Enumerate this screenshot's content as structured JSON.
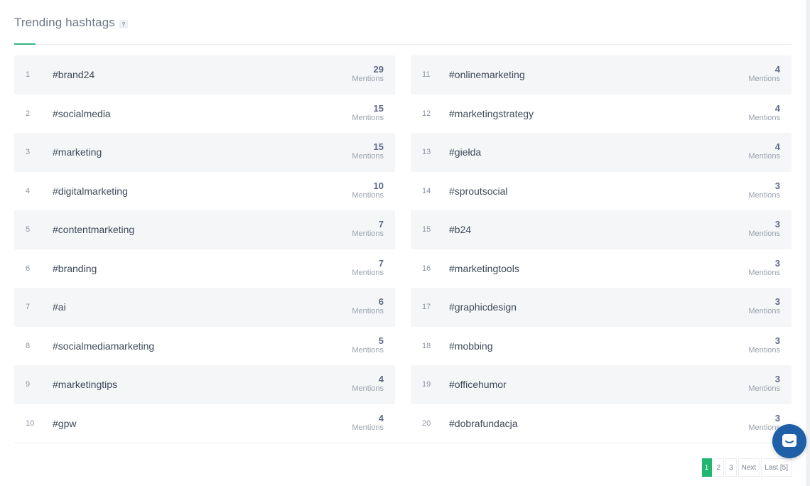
{
  "title": "Trending hashtags",
  "help_glyph": "?",
  "mentions_label": "Mentions",
  "hashtags_left": [
    {
      "rank": "1",
      "tag": "#brand24",
      "count": "29"
    },
    {
      "rank": "2",
      "tag": "#socialmedia",
      "count": "15"
    },
    {
      "rank": "3",
      "tag": "#marketing",
      "count": "15"
    },
    {
      "rank": "4",
      "tag": "#digitalmarketing",
      "count": "10"
    },
    {
      "rank": "5",
      "tag": "#contentmarketing",
      "count": "7"
    },
    {
      "rank": "6",
      "tag": "#branding",
      "count": "7"
    },
    {
      "rank": "7",
      "tag": "#ai",
      "count": "6"
    },
    {
      "rank": "8",
      "tag": "#socialmediamarketing",
      "count": "5"
    },
    {
      "rank": "9",
      "tag": "#marketingtips",
      "count": "4"
    },
    {
      "rank": "10",
      "tag": "#gpw",
      "count": "4"
    }
  ],
  "hashtags_right": [
    {
      "rank": "11",
      "tag": "#onlinemarketing",
      "count": "4"
    },
    {
      "rank": "12",
      "tag": "#marketingstrategy",
      "count": "4"
    },
    {
      "rank": "13",
      "tag": "#giełda",
      "count": "4"
    },
    {
      "rank": "14",
      "tag": "#sproutsocial",
      "count": "3"
    },
    {
      "rank": "15",
      "tag": "#b24",
      "count": "3"
    },
    {
      "rank": "16",
      "tag": "#marketingtools",
      "count": "3"
    },
    {
      "rank": "17",
      "tag": "#graphicdesign",
      "count": "3"
    },
    {
      "rank": "18",
      "tag": "#mobbing",
      "count": "3"
    },
    {
      "rank": "19",
      "tag": "#officehumor",
      "count": "3"
    },
    {
      "rank": "20",
      "tag": "#dobrafundacja",
      "count": "3"
    }
  ],
  "pagination": {
    "pages": [
      "1",
      "2",
      "3"
    ],
    "active": "1",
    "next": "Next",
    "last": "Last [5]"
  },
  "icons": {
    "chat": "chat-bubble-icon"
  },
  "colors": {
    "accent": "#34b883",
    "active_page": "#21b66f",
    "chat": "#1f5fa8"
  }
}
